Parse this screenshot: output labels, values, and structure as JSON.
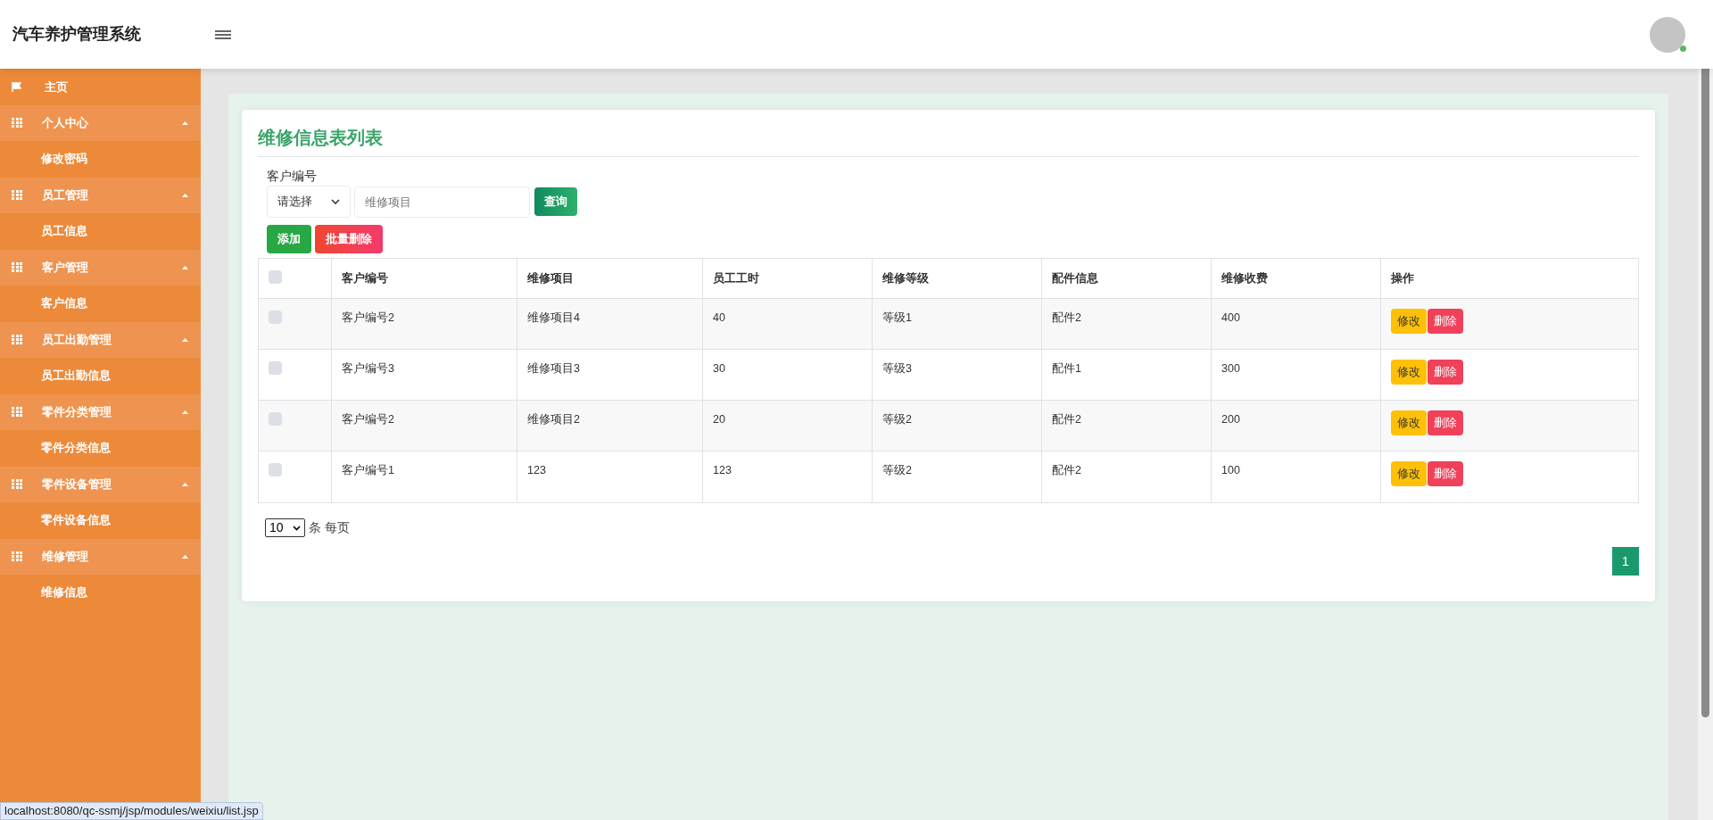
{
  "header": {
    "title": "汽车养护管理系统"
  },
  "sidebar": {
    "items": [
      {
        "kind": "home",
        "label": "主页"
      },
      {
        "kind": "group",
        "label": "个人中心",
        "expanded": true,
        "children": [
          {
            "label": "修改密码"
          }
        ]
      },
      {
        "kind": "group",
        "label": "员工管理",
        "expanded": true,
        "children": [
          {
            "label": "员工信息"
          }
        ]
      },
      {
        "kind": "group",
        "label": "客户管理",
        "expanded": true,
        "children": [
          {
            "label": "客户信息"
          }
        ]
      },
      {
        "kind": "group",
        "label": "员工出勤管理",
        "expanded": true,
        "children": [
          {
            "label": "员工出勤信息"
          }
        ]
      },
      {
        "kind": "group",
        "label": "零件分类管理",
        "expanded": true,
        "children": [
          {
            "label": "零件分类信息"
          }
        ]
      },
      {
        "kind": "group",
        "label": "零件设备管理",
        "expanded": true,
        "children": [
          {
            "label": "零件设备信息"
          }
        ]
      },
      {
        "kind": "group",
        "label": "维修管理",
        "expanded": true,
        "children": [
          {
            "label": "维修信息"
          }
        ]
      }
    ]
  },
  "page": {
    "title": "维修信息表列表",
    "filter": {
      "label": "客户编号",
      "select": {
        "value": "请选择"
      },
      "search": {
        "placeholder": "维修项目"
      },
      "button": "查询"
    },
    "actions": [
      "添加",
      "批量删除"
    ],
    "table": {
      "select_all": {
        "checked": false
      },
      "columns": [
        "客户编号",
        "维修项目",
        "员工工时",
        "维修等级",
        "配件信息",
        "维修收费",
        "操作"
      ],
      "rows": [
        {
          "checked": false,
          "cells": [
            "客户编号2",
            "维修项目4",
            "40",
            "等级1",
            "配件2",
            "400"
          ],
          "buttons": [
            "修改",
            "删除"
          ]
        },
        {
          "checked": false,
          "cells": [
            "客户编号3",
            "维修项目3",
            "30",
            "等级3",
            "配件1",
            "300"
          ],
          "buttons": [
            "修改",
            "删除"
          ]
        },
        {
          "checked": false,
          "cells": [
            "客户编号2",
            "维修项目2",
            "20",
            "等级2",
            "配件2",
            "200"
          ],
          "buttons": [
            "修改",
            "删除"
          ]
        },
        {
          "checked": false,
          "cells": [
            "客户编号1",
            "123",
            "123",
            "等级2",
            "配件2",
            "100"
          ],
          "buttons": [
            "修改",
            "删除"
          ]
        }
      ]
    },
    "page_size": {
      "value": "10",
      "label": "条 每页"
    },
    "pagination": [
      {
        "label": "1",
        "selected": true
      }
    ]
  },
  "status_url": "localhost:8080/qc-ssmj/jsp/modules/weixiu/list.jsp"
}
